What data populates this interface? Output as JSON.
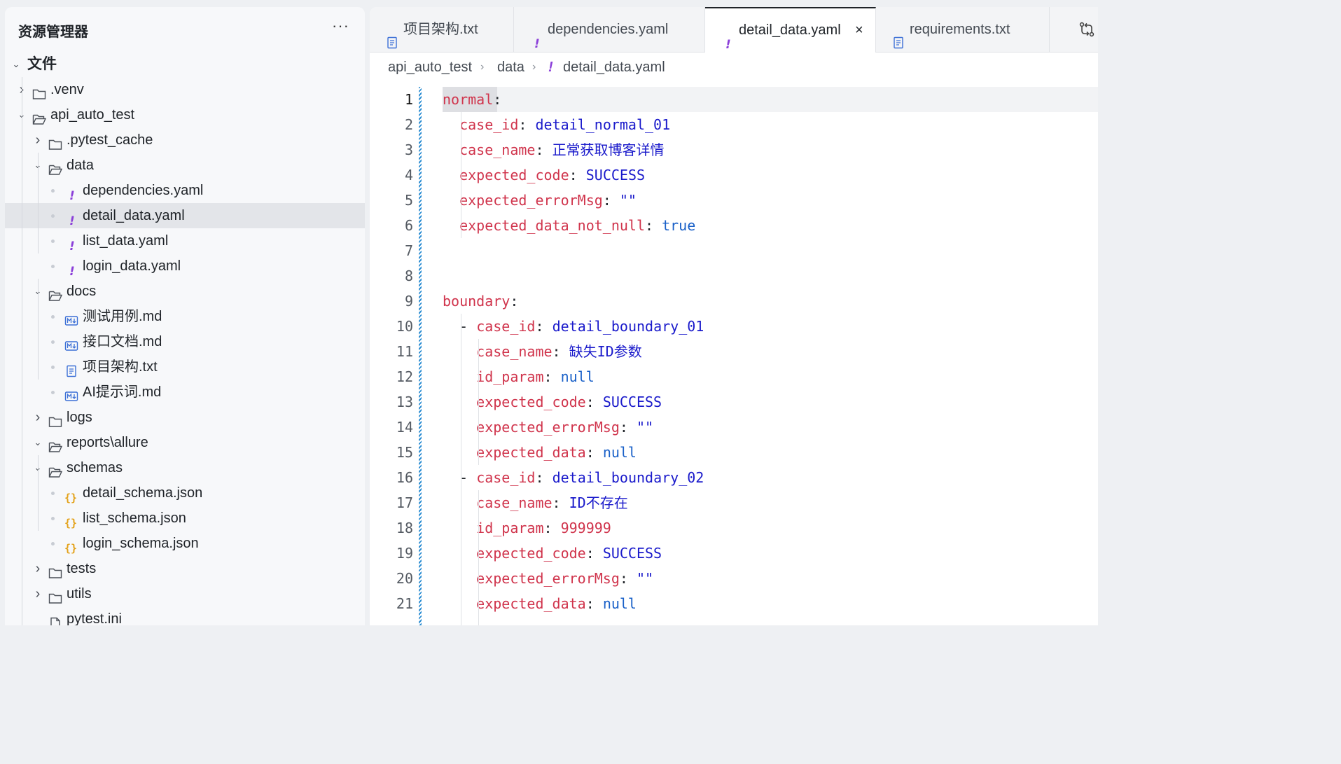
{
  "explorer": {
    "title": "资源管理器",
    "more": "···",
    "root": "文件",
    "rows": [
      {
        "label": ".venv",
        "type": "folder",
        "depth": 1,
        "expanded": false
      },
      {
        "label": "api_auto_test",
        "type": "folder-open",
        "depth": 1,
        "expanded": true
      },
      {
        "label": ".pytest_cache",
        "type": "folder",
        "depth": 2,
        "expanded": false
      },
      {
        "label": "data",
        "type": "folder-open",
        "depth": 2,
        "expanded": true
      },
      {
        "label": "dependencies.yaml",
        "type": "yaml",
        "depth": 3
      },
      {
        "label": "detail_data.yaml",
        "type": "yaml",
        "depth": 3,
        "selected": true
      },
      {
        "label": "list_data.yaml",
        "type": "yaml",
        "depth": 3
      },
      {
        "label": "login_data.yaml",
        "type": "yaml",
        "depth": 3
      },
      {
        "label": "docs",
        "type": "folder-open",
        "depth": 2,
        "expanded": true
      },
      {
        "label": "测试用例.md",
        "type": "md",
        "depth": 3
      },
      {
        "label": "接口文档.md",
        "type": "md",
        "depth": 3
      },
      {
        "label": "项目架构.txt",
        "type": "txt",
        "depth": 3
      },
      {
        "label": "AI提示词.md",
        "type": "md",
        "depth": 3
      },
      {
        "label": "logs",
        "type": "folder",
        "depth": 2,
        "expanded": false
      },
      {
        "label": "reports\\allure",
        "type": "folder-open",
        "depth": 2,
        "expanded": true
      },
      {
        "label": "schemas",
        "type": "folder-open",
        "depth": 2,
        "expanded": true
      },
      {
        "label": "detail_schema.json",
        "type": "json",
        "depth": 3
      },
      {
        "label": "list_schema.json",
        "type": "json",
        "depth": 3
      },
      {
        "label": "login_schema.json",
        "type": "json",
        "depth": 3
      },
      {
        "label": "tests",
        "type": "folder",
        "depth": 2,
        "expanded": false
      },
      {
        "label": "utils",
        "type": "folder",
        "depth": 2,
        "expanded": false
      },
      {
        "label": "pytest.ini",
        "type": "file",
        "depth": 2
      }
    ]
  },
  "tabs": [
    {
      "label": "项目架构.txt",
      "icon": "txt-file-icon",
      "active": false
    },
    {
      "label": "dependencies.yaml",
      "icon": "yaml-file-icon",
      "active": false
    },
    {
      "label": "detail_data.yaml",
      "icon": "yaml-file-icon",
      "active": true,
      "close": "×"
    },
    {
      "label": "requirements.txt",
      "icon": "txt-file-icon",
      "active": false
    }
  ],
  "breadcrumb": {
    "parts": [
      "api_auto_test",
      "data",
      "detail_data.yaml"
    ],
    "yaml_mark": "!"
  },
  "editor": {
    "current_line": 1,
    "lines": [
      [
        {
          "t": "normal",
          "c": "k"
        },
        {
          "t": ":",
          "c": "p"
        }
      ],
      [
        {
          "t": "  "
        },
        {
          "t": "case_id",
          "c": "k"
        },
        {
          "t": ": ",
          "c": "p"
        },
        {
          "t": "detail_normal_01",
          "c": "v"
        }
      ],
      [
        {
          "t": "  "
        },
        {
          "t": "case_name",
          "c": "k"
        },
        {
          "t": ": ",
          "c": "p"
        },
        {
          "t": "正常获取博客详情",
          "c": "v"
        }
      ],
      [
        {
          "t": "  "
        },
        {
          "t": "expected_code",
          "c": "k"
        },
        {
          "t": ": ",
          "c": "p"
        },
        {
          "t": "SUCCESS",
          "c": "v"
        }
      ],
      [
        {
          "t": "  "
        },
        {
          "t": "expected_errorMsg",
          "c": "k"
        },
        {
          "t": ": ",
          "c": "p"
        },
        {
          "t": "\"\"",
          "c": "v"
        }
      ],
      [
        {
          "t": "  "
        },
        {
          "t": "expected_data_not_null",
          "c": "k"
        },
        {
          "t": ": ",
          "c": "p"
        },
        {
          "t": "true",
          "c": "b"
        }
      ],
      [],
      [],
      [
        {
          "t": "boundary",
          "c": "k"
        },
        {
          "t": ":",
          "c": "p"
        }
      ],
      [
        {
          "t": "  "
        },
        {
          "t": "- ",
          "c": "p"
        },
        {
          "t": "case_id",
          "c": "k"
        },
        {
          "t": ": ",
          "c": "p"
        },
        {
          "t": "detail_boundary_01",
          "c": "v"
        }
      ],
      [
        {
          "t": "    "
        },
        {
          "t": "case_name",
          "c": "k"
        },
        {
          "t": ": ",
          "c": "p"
        },
        {
          "t": "缺失ID参数",
          "c": "v"
        }
      ],
      [
        {
          "t": "    "
        },
        {
          "t": "id_param",
          "c": "k"
        },
        {
          "t": ": ",
          "c": "p"
        },
        {
          "t": "null",
          "c": "b"
        }
      ],
      [
        {
          "t": "    "
        },
        {
          "t": "expected_code",
          "c": "k"
        },
        {
          "t": ": ",
          "c": "p"
        },
        {
          "t": "SUCCESS",
          "c": "v"
        }
      ],
      [
        {
          "t": "    "
        },
        {
          "t": "expected_errorMsg",
          "c": "k"
        },
        {
          "t": ": ",
          "c": "p"
        },
        {
          "t": "\"\"",
          "c": "v"
        }
      ],
      [
        {
          "t": "    "
        },
        {
          "t": "expected_data",
          "c": "k"
        },
        {
          "t": ": ",
          "c": "p"
        },
        {
          "t": "null",
          "c": "b"
        }
      ],
      [
        {
          "t": "  "
        },
        {
          "t": "- ",
          "c": "p"
        },
        {
          "t": "case_id",
          "c": "k"
        },
        {
          "t": ": ",
          "c": "p"
        },
        {
          "t": "detail_boundary_02",
          "c": "v"
        }
      ],
      [
        {
          "t": "    "
        },
        {
          "t": "case_name",
          "c": "k"
        },
        {
          "t": ": ",
          "c": "p"
        },
        {
          "t": "ID不存在",
          "c": "v"
        }
      ],
      [
        {
          "t": "    "
        },
        {
          "t": "id_param",
          "c": "k"
        },
        {
          "t": ": ",
          "c": "p"
        },
        {
          "t": "999999",
          "c": "n"
        }
      ],
      [
        {
          "t": "    "
        },
        {
          "t": "expected_code",
          "c": "k"
        },
        {
          "t": ": ",
          "c": "p"
        },
        {
          "t": "SUCCESS",
          "c": "v"
        }
      ],
      [
        {
          "t": "    "
        },
        {
          "t": "expected_errorMsg",
          "c": "k"
        },
        {
          "t": ": ",
          "c": "p"
        },
        {
          "t": "\"\"",
          "c": "v"
        }
      ],
      [
        {
          "t": "    "
        },
        {
          "t": "expected_data",
          "c": "k"
        },
        {
          "t": ": ",
          "c": "p"
        },
        {
          "t": "null",
          "c": "b"
        }
      ]
    ]
  },
  "colors": {
    "key": "#d0344c",
    "string": "#1a1acb",
    "literal": "#1960c8",
    "yaml_icon": "#8b3fd9",
    "md_icon": "#3b6fd6",
    "json_icon": "#e3a21a"
  }
}
